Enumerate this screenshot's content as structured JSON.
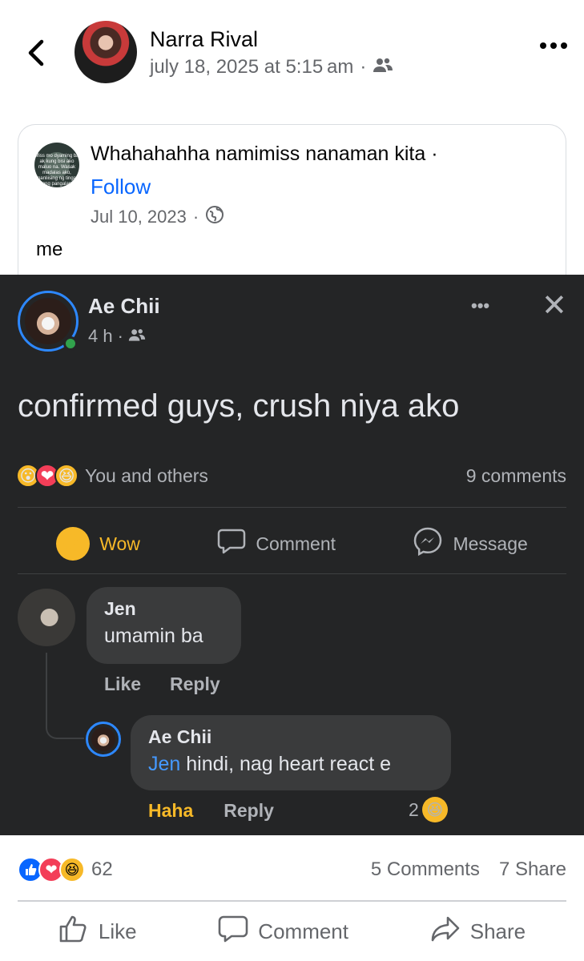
{
  "header": {
    "author": "Narra Rival",
    "timestamp": "july 18, 2025 at 5:15 am",
    "separator": "·",
    "audience_icon": "friends-icon",
    "more_icon": "more-dots-icon"
  },
  "shared_post": {
    "avatar_text": "Miss mo dyaming ba ak kung bisi ako maluo na. Wasak madalas ako, nanliising ng tinga ang pangalan",
    "title": "Whahahahha namimiss nanaman kita",
    "separator": "·",
    "follow_label": "Follow",
    "date": "Jul 10, 2023",
    "audience_icon": "globe-icon",
    "caption": "me"
  },
  "dark_post": {
    "author": "Ae Chii",
    "time": "4 h",
    "separator": "·",
    "audience_icon": "friends-icon",
    "more": "•••",
    "close": "✕",
    "text": "confirmed guys, crush niya ako",
    "reactions_text": "You and others",
    "comments_count": "9 comments",
    "actions": {
      "wow": "Wow",
      "comment": "Comment",
      "message": "Message"
    },
    "comment": {
      "author": "Jen",
      "text": "umamin ba",
      "like": "Like",
      "reply": "Reply"
    },
    "reply": {
      "author": "Ae Chii",
      "mention": "Jen",
      "text": " hindi, nag heart react e",
      "haha": "Haha",
      "reply": "Reply",
      "reaction_count": "2"
    }
  },
  "stats": {
    "reaction_count": "62",
    "comments": "5 Comments",
    "shares": "7 Share"
  },
  "actions": {
    "like": "Like",
    "comment": "Comment",
    "share": "Share"
  },
  "colors": {
    "accent_blue": "#0866ff",
    "wow_yellow": "#f7b928",
    "love_red": "#f33e58",
    "dark_bg": "#242526"
  }
}
